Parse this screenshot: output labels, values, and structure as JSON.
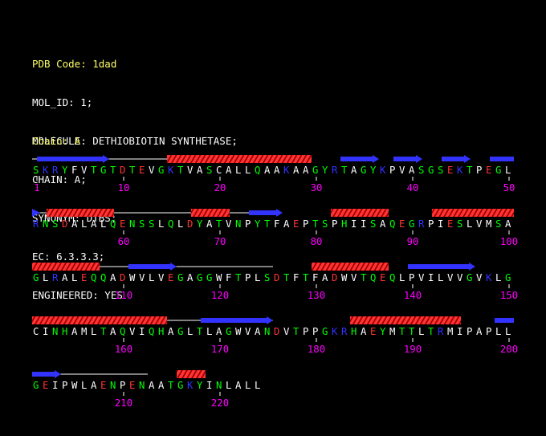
{
  "pdb_code": "PDB Code: 1dad",
  "header_lines": [
    "MOL_ID: 1;",
    "MOLECULE: DETHIOBIOTIN SYNTHETASE;",
    "CHAIN: A;",
    "SYNONYM: DTBS;",
    "EC: 6.3.3.3;",
    "ENGINEERED: YES"
  ],
  "chain_label": "Chain: A",
  "colors": {
    "background": "#000000",
    "header_text": "#ffffff",
    "accent_text": "#ffff66",
    "residue_number": "#ff00ff",
    "backbone_line": "#ffffff",
    "strand": "#3333ff",
    "helix_fill": "#ff3333",
    "helix_stripe": "#990000",
    "residue_hydrophobic": "#ffffff",
    "residue_polar": "#00ff00",
    "residue_acidic": "#ff3333",
    "residue_basic": "#3333ff"
  },
  "residue_color_groups": {
    "hydrophobic": "AVLIMFPWC",
    "polar": "GSTYNQH",
    "acidic": "DE",
    "basic": "KR"
  },
  "sequence_rows": [
    {
      "sequence": "SKRYFVTGTDTEVGKTVASCALLQAAKAAGYRTAGYKPVASGSEKTPEGL",
      "number_labels": [
        "1",
        "10",
        "20",
        "30",
        "40",
        "50"
      ],
      "elements": [
        {
          "type": "strand",
          "start": 2,
          "end": 16
        },
        {
          "type": "helix",
          "start": 29,
          "end": 58
        },
        {
          "type": "strand",
          "start": 65,
          "end": 72
        },
        {
          "type": "strand",
          "start": 76,
          "end": 81
        },
        {
          "type": "strand",
          "start": 86,
          "end": 91
        },
        {
          "type": "strand",
          "start": 96,
          "end": 100
        }
      ]
    },
    {
      "sequence": "RNSDALALQENSSLQLDYATVNPYTFAEPTSPHIISAQEGRPIESLVMSA",
      "number_labels": [
        "60",
        "70",
        "80",
        "90",
        "100"
      ],
      "elements": [
        {
          "type": "strand",
          "start": 1,
          "end": 1
        },
        {
          "type": "helix",
          "start": 4,
          "end": 17
        },
        {
          "type": "helix",
          "start": 34,
          "end": 41
        },
        {
          "type": "strand",
          "start": 46,
          "end": 52
        },
        {
          "type": "helix",
          "start": 63,
          "end": 74
        },
        {
          "type": "helix",
          "start": 84,
          "end": 100
        }
      ]
    },
    {
      "sequence": "GLRALEQQADWVLVEGAGGWFTPLSDTFTFADWVTQEQLPVILVVGVKLG",
      "number_labels": [
        "110",
        "120",
        "130",
        "140",
        "150"
      ],
      "elements": [
        {
          "type": "helix",
          "start": 1,
          "end": 14
        },
        {
          "type": "strand",
          "start": 21,
          "end": 30
        },
        {
          "type": "helix",
          "start": 59,
          "end": 74
        },
        {
          "type": "strand",
          "start": 79,
          "end": 92
        }
      ]
    },
    {
      "sequence": "CINHAMLTAQVIQHAGLTLAGWVANDVTPPGKRHAEYMTTLTRMIPAPLL",
      "number_labels": [
        "160",
        "170",
        "180",
        "190",
        "200"
      ],
      "elements": [
        {
          "type": "helix",
          "start": 1,
          "end": 28
        },
        {
          "type": "strand",
          "start": 36,
          "end": 50
        },
        {
          "type": "helix",
          "start": 67,
          "end": 89
        },
        {
          "type": "strand",
          "start": 97,
          "end": 100
        }
      ]
    },
    {
      "sequence": "GEIPWLAENPENAATGKYINLALL",
      "number_labels": [
        "210",
        "220"
      ],
      "elements": [
        {
          "type": "strand",
          "start": 1,
          "end": 6
        },
        {
          "type": "helix",
          "start": 31,
          "end": 36
        }
      ]
    }
  ]
}
